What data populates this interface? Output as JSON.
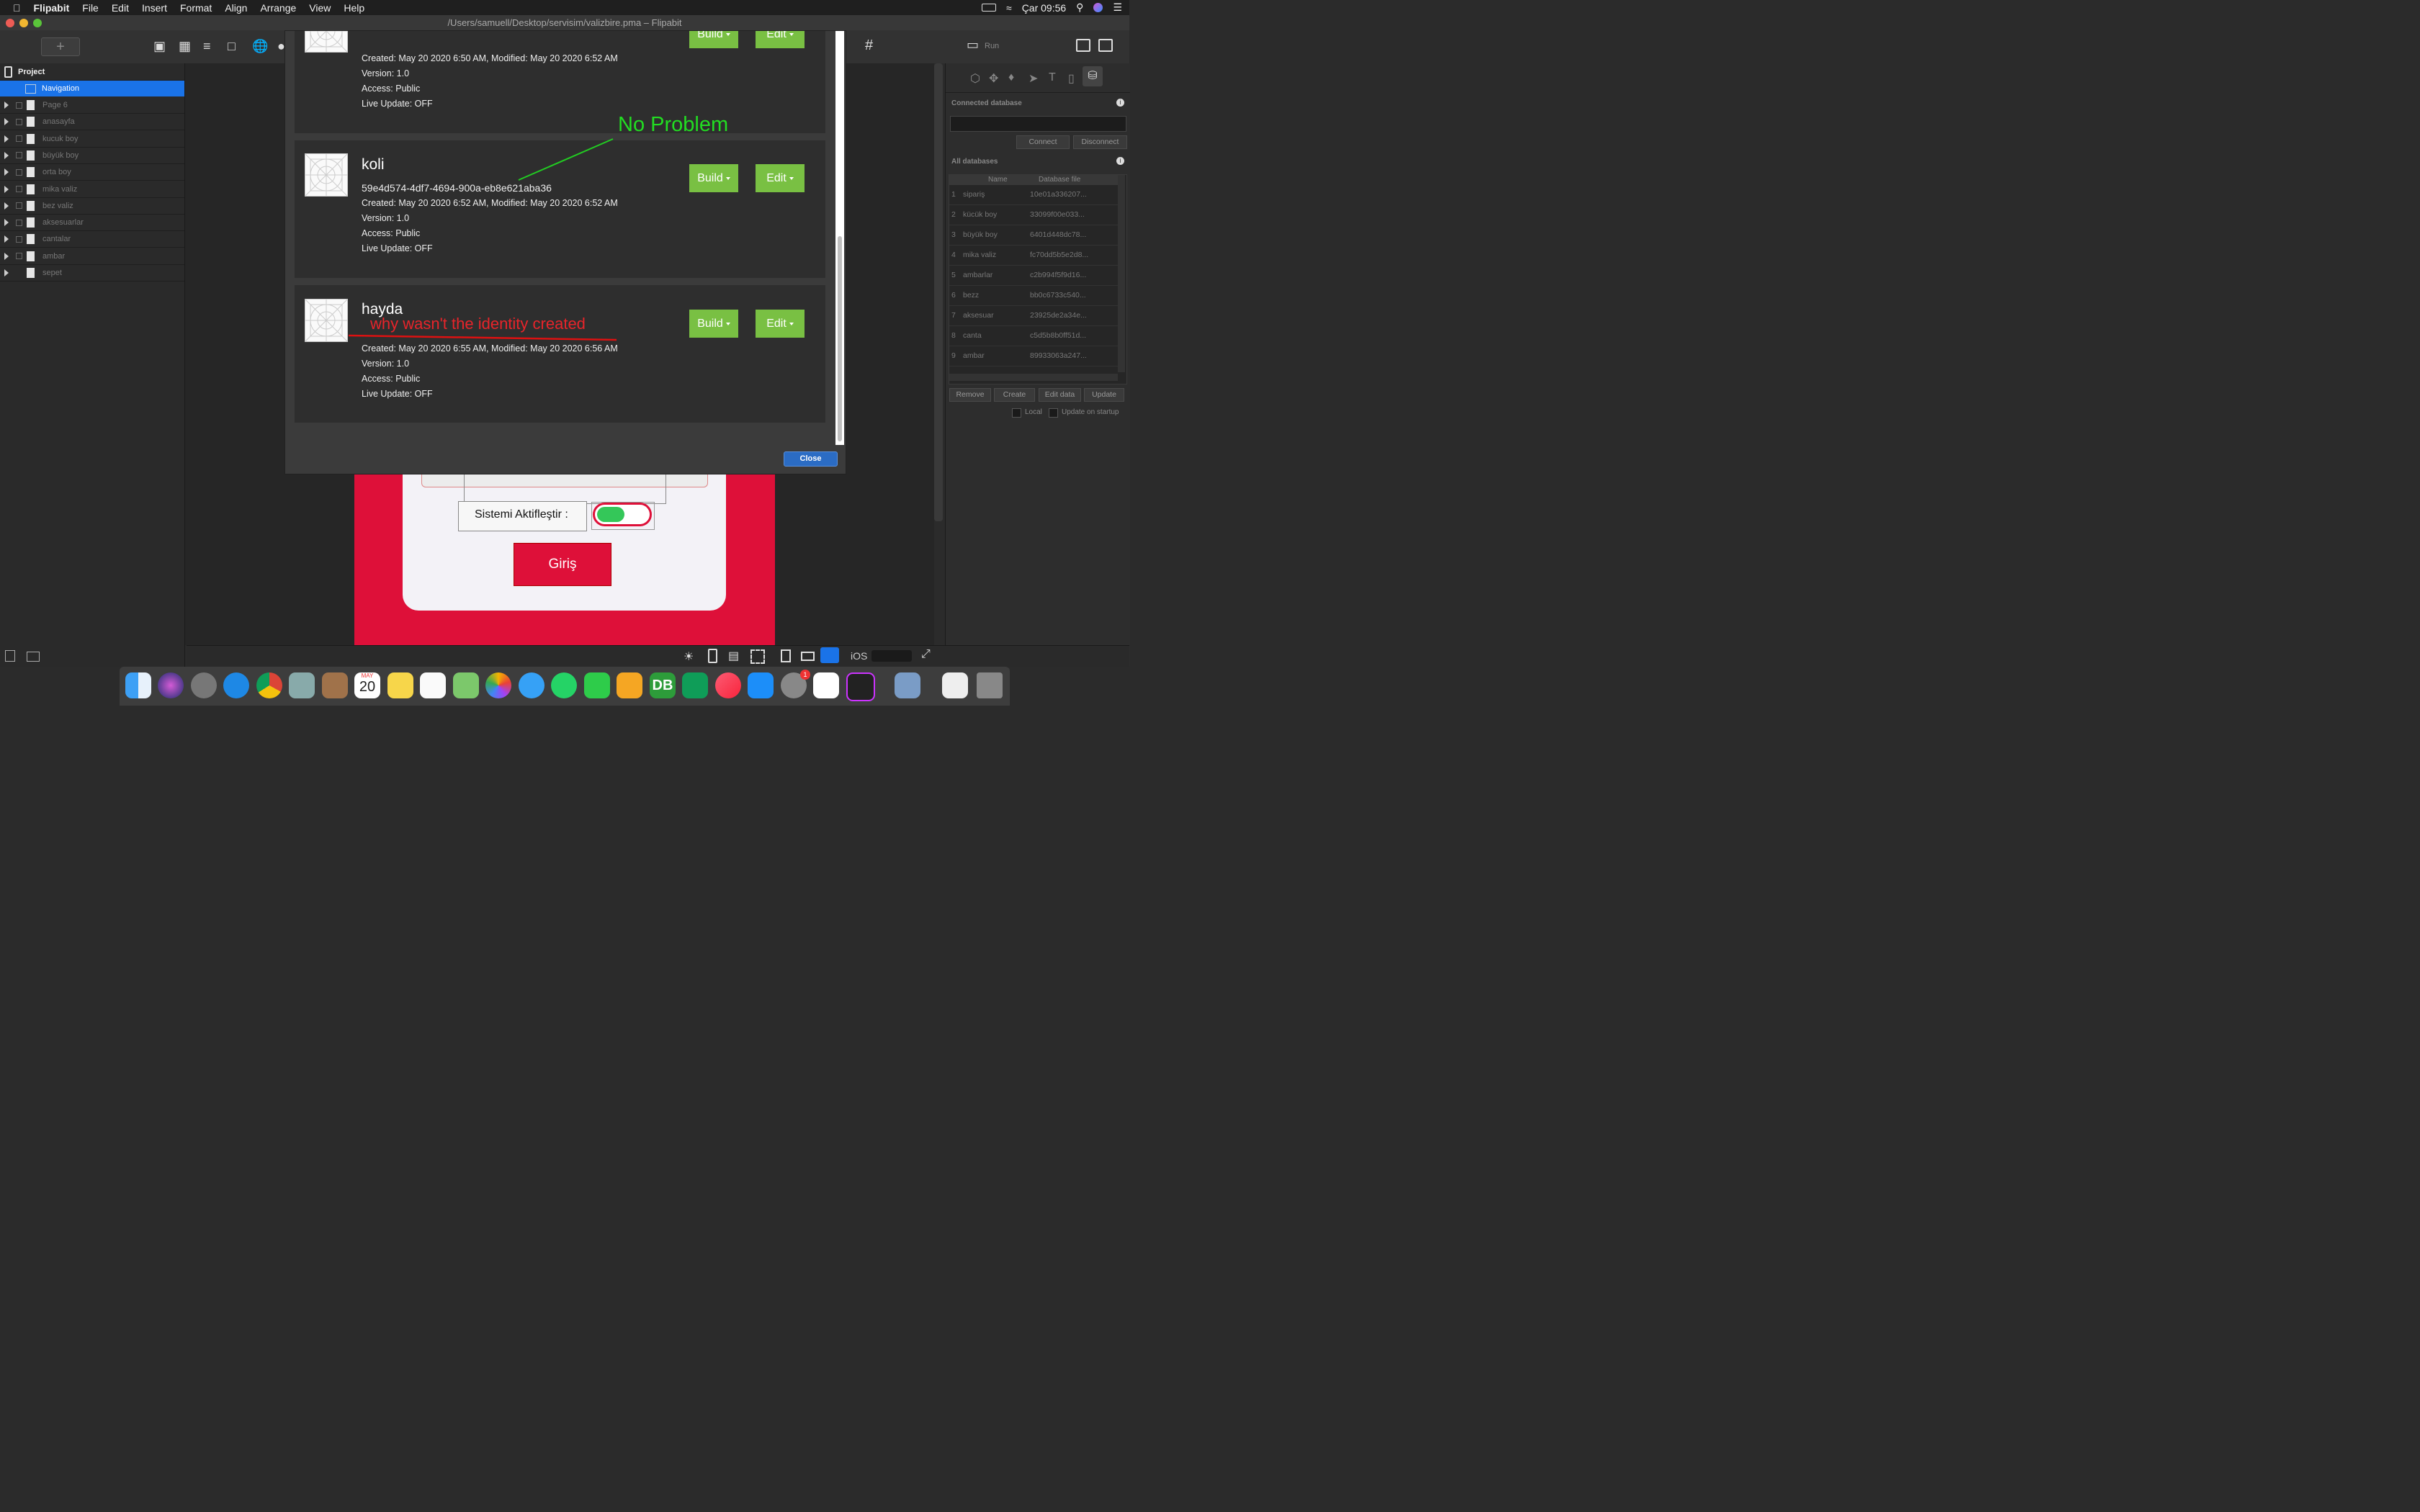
{
  "menubar": {
    "app_name": "Flipabit",
    "items": [
      "File",
      "Edit",
      "Insert",
      "Format",
      "Align",
      "Arrange",
      "View",
      "Help"
    ],
    "clock": "Çar 09:56"
  },
  "window": {
    "title": "/Users/samuell/Desktop/servisim/valizbire.pma – Flipabit"
  },
  "toolbar": {
    "add_label": "+",
    "run_label": "Run"
  },
  "project_tree": {
    "header": "Project",
    "selected": "Navigation",
    "items": [
      "Page 6",
      "anasayfa",
      "kucuk boy",
      "büyük boy",
      "orta boy",
      "mika valiz",
      "bez valiz",
      "aksesuarlar",
      "cantalar",
      "ambar",
      "sepet"
    ]
  },
  "modal": {
    "projects": [
      {
        "title": "",
        "id": "",
        "created": "Created: May 20 2020 6:50 AM, Modified: May 20 2020 6:52 AM",
        "version": "Version: 1.0",
        "access": "Access: Public",
        "live_update": "Live Update: OFF"
      },
      {
        "title": "koli",
        "id": "59e4d574-4df7-4694-900a-eb8e621aba36",
        "created": "Created: May 20 2020 6:52 AM, Modified: May 20 2020 6:52 AM",
        "version": "Version: 1.0",
        "access": "Access: Public",
        "live_update": "Live Update: OFF"
      },
      {
        "title": "hayda",
        "id": "",
        "created": "Created: May 20 2020 6:55 AM, Modified: May 20 2020 6:56 AM",
        "version": "Version: 1.0",
        "access": "Access: Public",
        "live_update": "Live Update: OFF"
      }
    ],
    "build_label": "Build",
    "edit_label": "Edit",
    "close_label": "Close",
    "annotation_ok": "No Problem",
    "annotation_question": "why wasn't the identity created"
  },
  "canvas": {
    "toggle_label": "Sistemi Aktifleştir :",
    "login_button": "Giriş",
    "toggle_on": true,
    "accent_red": "#de1039",
    "toggle_green": "#34c759"
  },
  "right_panel": {
    "connected_db_label": "Connected database",
    "connect_label": "Connect",
    "disconnect_label": "Disconnect",
    "all_db_label": "All databases",
    "columns": [
      "Name",
      "Database file"
    ],
    "databases": [
      {
        "n": "1",
        "name": "sipariş",
        "file": "10e01a336207..."
      },
      {
        "n": "2",
        "name": "kücük boy",
        "file": "33099f00e033..."
      },
      {
        "n": "3",
        "name": "büyük boy",
        "file": "6401d448dc78..."
      },
      {
        "n": "4",
        "name": "mika valiz",
        "file": "fc70dd5b5e2d8..."
      },
      {
        "n": "5",
        "name": "ambarlar",
        "file": "c2b994f5f9d16..."
      },
      {
        "n": "6",
        "name": "bezz",
        "file": "bb0c6733c540..."
      },
      {
        "n": "7",
        "name": "aksesuar",
        "file": "23925de2a34e..."
      },
      {
        "n": "8",
        "name": "canta",
        "file": "c5d5b8b0ff51d..."
      },
      {
        "n": "9",
        "name": "ambar",
        "file": "89933063a247..."
      }
    ],
    "remove_label": "Remove",
    "create_label": "Create",
    "edit_data_label": "Edit data",
    "update_label": "Update",
    "local_label": "Local",
    "update_startup_label": "Update on startup"
  },
  "bottombar": {
    "platform_label": "iOS"
  },
  "dock": {
    "calendar_month": "MAY",
    "calendar_day": "20",
    "db_label": "DB",
    "settings_badge": "1"
  }
}
